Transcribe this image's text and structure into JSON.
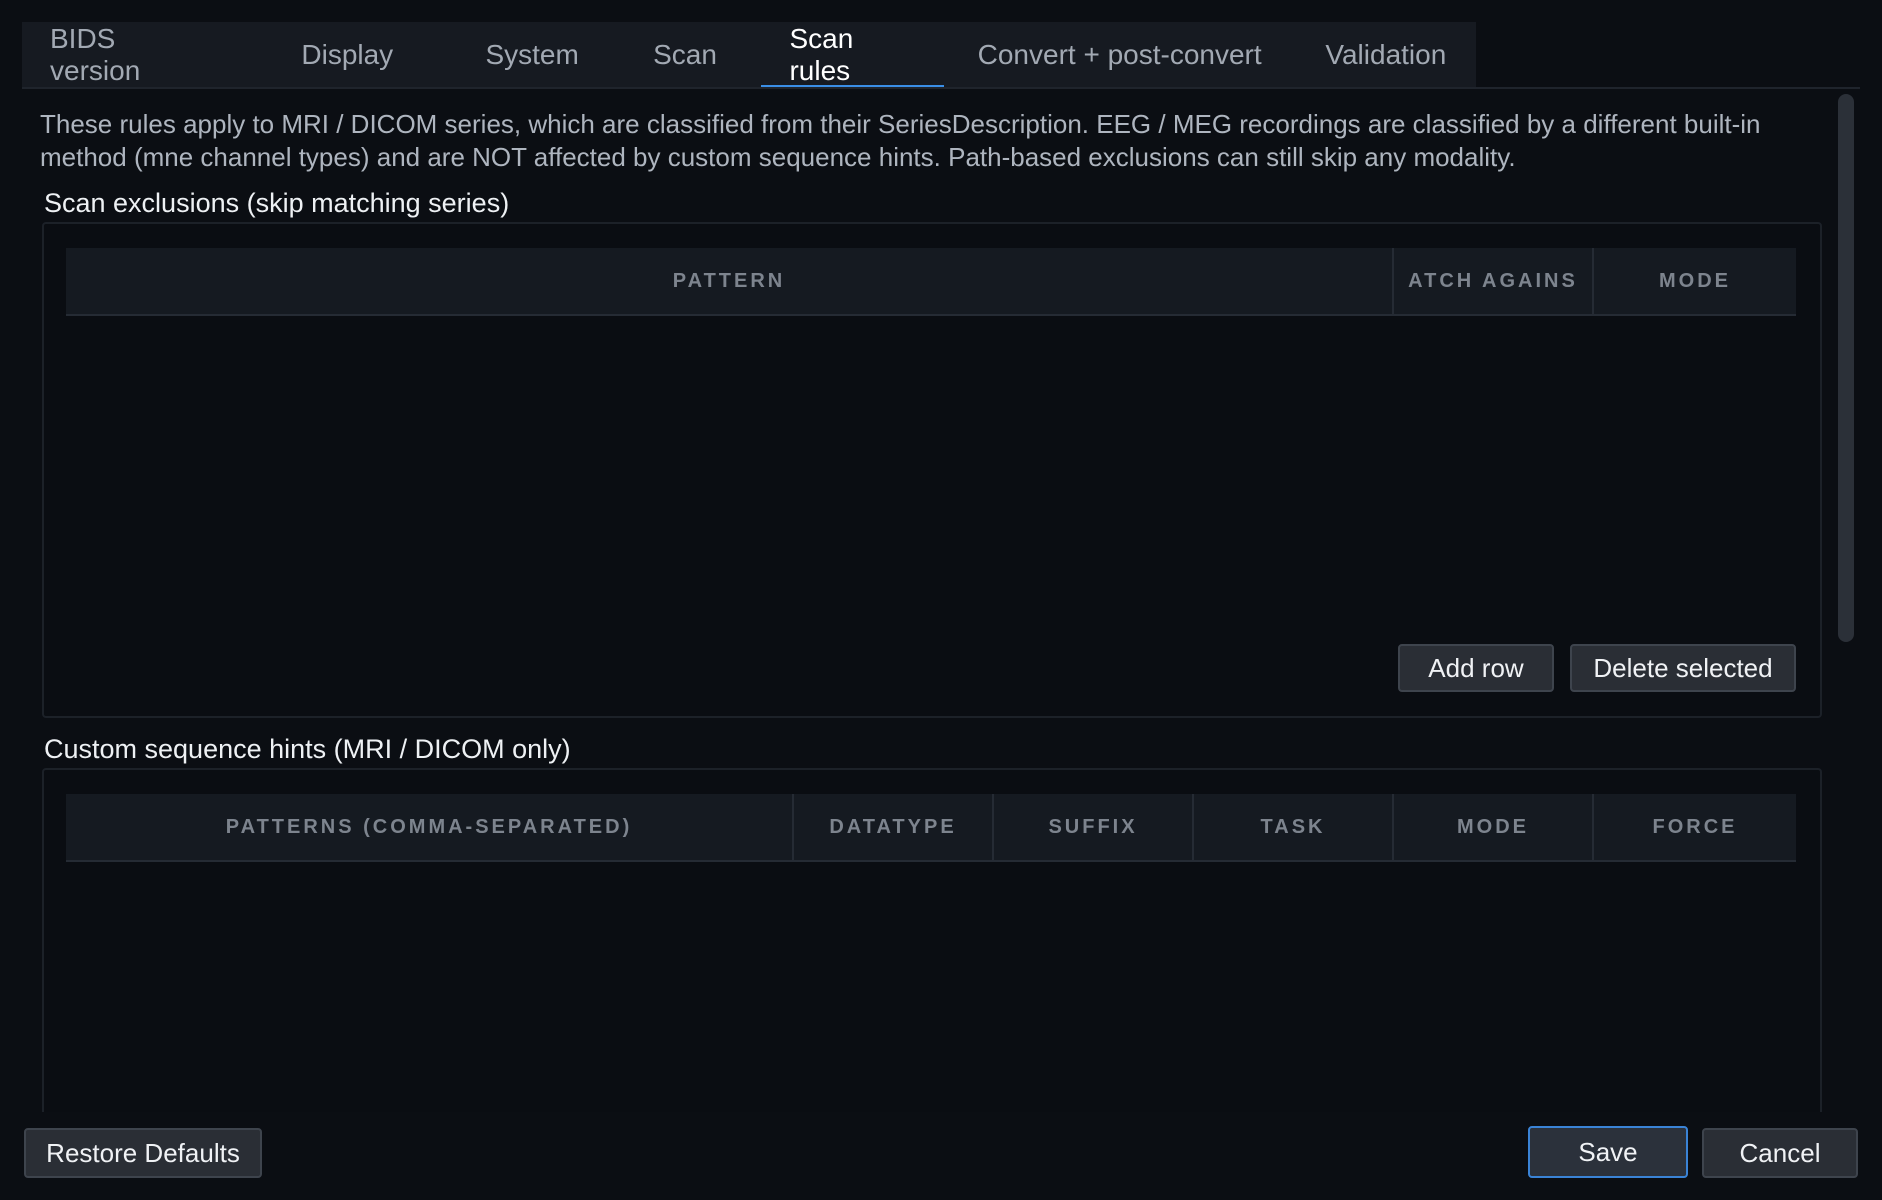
{
  "tabs": [
    {
      "label": "BIDS version",
      "active": false
    },
    {
      "label": "Display",
      "active": false
    },
    {
      "label": "System",
      "active": false
    },
    {
      "label": "Scan",
      "active": false
    },
    {
      "label": "Scan rules",
      "active": true
    },
    {
      "label": "Convert + post-convert",
      "active": false
    },
    {
      "label": "Validation",
      "active": false
    }
  ],
  "intro_text": "These rules apply to MRI / DICOM series, which are classified from their SeriesDescription. EEG / MEG recordings are classified by a different built-in method (mne channel types) and are NOT affected by custom sequence hints. Path-based exclusions can still skip any modality.",
  "exclusions": {
    "title": "Scan exclusions (skip matching series)",
    "columns": [
      "PATTERN",
      "ATCH AGAINS",
      "MODE"
    ],
    "rows": [],
    "add_row_label": "Add row",
    "delete_selected_label": "Delete selected"
  },
  "hints": {
    "title": "Custom sequence hints (MRI / DICOM only)",
    "columns": [
      "PATTERNS (COMMA-SEPARATED)",
      "DATATYPE",
      "SUFFIX",
      "TASK",
      "MODE",
      "FORCE"
    ],
    "rows": []
  },
  "footer": {
    "restore_defaults_label": "Restore Defaults",
    "save_label": "Save",
    "cancel_label": "Cancel"
  },
  "colors": {
    "background": "#0b0e13",
    "accent": "#3a8ee6",
    "header_bg": "#151a21"
  }
}
